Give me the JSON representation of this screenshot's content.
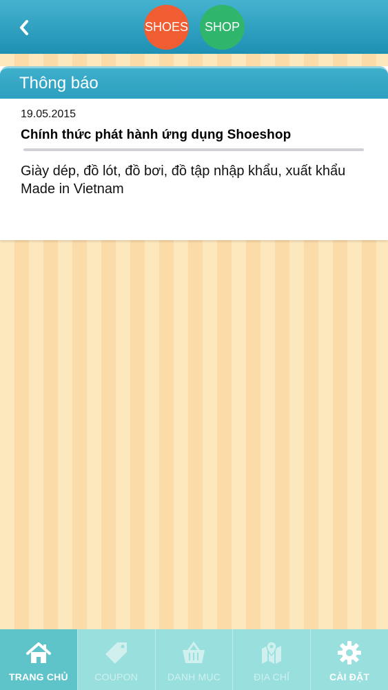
{
  "header": {
    "logo_left": "SHOES",
    "logo_right": "SHOP"
  },
  "notice": {
    "section_title": "Thông báo",
    "date": "19.05.2015",
    "title": "Chính thức phát hành ứng dụng Shoeshop",
    "body_line1": "Giày dép, đồ lót, đồ bơi, đồ tập nhập khẩu, xuất khẩu",
    "body_line2": "Made in Vietnam"
  },
  "tabs": [
    {
      "label": "TRANG CHỦ",
      "icon": "home-icon",
      "active": true
    },
    {
      "label": "COUPON",
      "icon": "tag-icon",
      "active": false
    },
    {
      "label": "DANH MỤC",
      "icon": "basket-icon",
      "active": false
    },
    {
      "label": "ĐỊA CHỈ",
      "icon": "map-pin-icon",
      "active": false
    },
    {
      "label": "CÀI ĐẶT",
      "icon": "gear-icon",
      "active": false
    }
  ],
  "colors": {
    "header": "#2a9fc1",
    "shoes_badge": "#f15d32",
    "shop_badge": "#2fb66c",
    "tabbar": "#98dfdd",
    "tab_active": "#5ec4c9"
  }
}
